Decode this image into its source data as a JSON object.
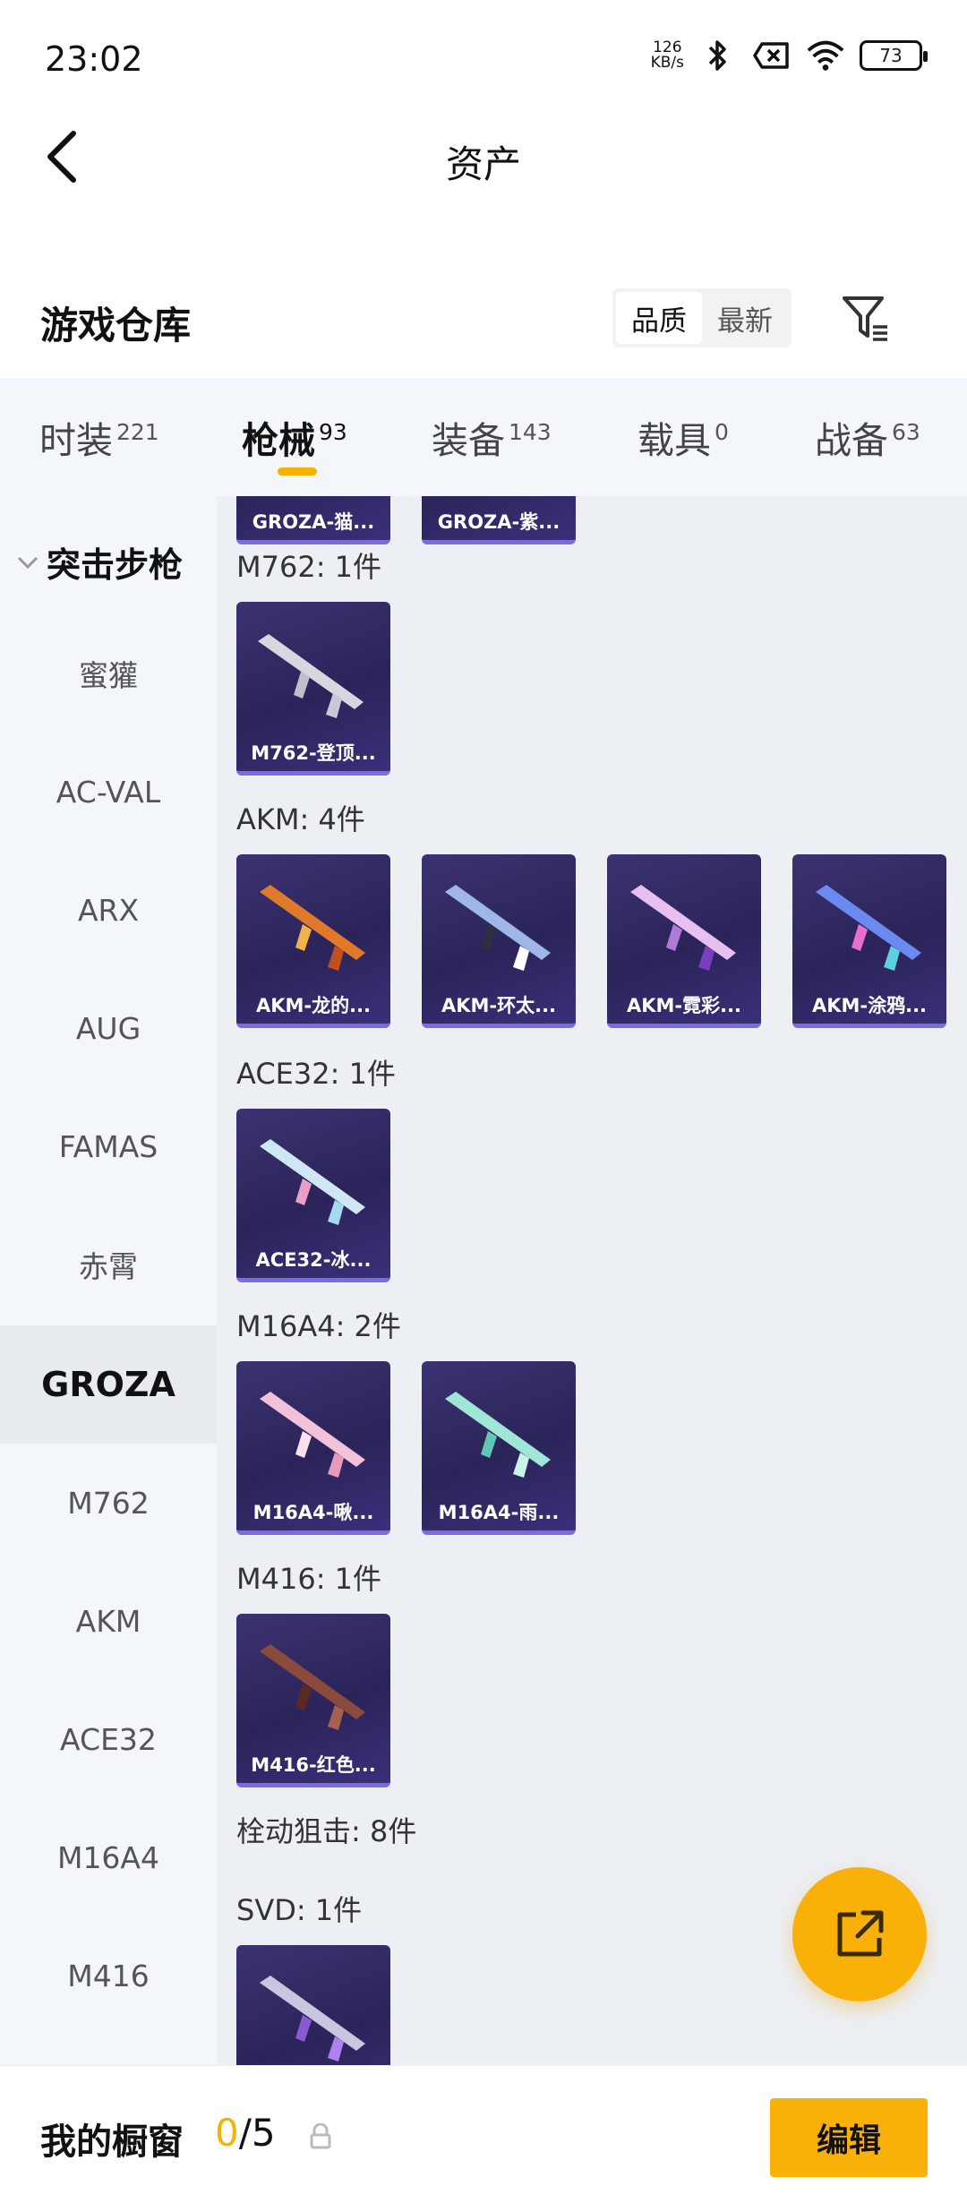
{
  "status": {
    "time": "23:02",
    "speed_top": "126",
    "speed_bottom": "KB/s",
    "battery": "73"
  },
  "header": {
    "title": "资产",
    "back_icon": "back-chevron-icon"
  },
  "warehouse": {
    "title": "游戏仓库",
    "sort_options": [
      "品质",
      "最新"
    ],
    "active_sort": "品质",
    "filter_icon": "filter-icon"
  },
  "tabs": [
    {
      "label": "时装",
      "count": "221"
    },
    {
      "label": "枪械",
      "count": "93"
    },
    {
      "label": "装备",
      "count": "143"
    },
    {
      "label": "载具",
      "count": "0"
    },
    {
      "label": "战备",
      "count": "63"
    }
  ],
  "active_tab": "枪械",
  "sidebar": {
    "group": "突击步枪",
    "items": [
      "蜜獾",
      "AC-VAL",
      "ARX",
      "AUG",
      "FAMAS",
      "赤霄",
      "GROZA",
      "M762",
      "AKM",
      "ACE32",
      "M16A4",
      "M416"
    ],
    "active": "GROZA"
  },
  "content": {
    "partial_cards": [
      "GROZA-猫...",
      "GROZA-紫..."
    ],
    "groups": [
      {
        "label": "M762: 1件",
        "items": [
          "M762-登顶..."
        ]
      },
      {
        "label": "AKM: 4件",
        "items": [
          "AKM-龙的...",
          "AKM-环太...",
          "AKM-霓彩...",
          "AKM-涂鸦..."
        ]
      },
      {
        "label": "ACE32: 1件",
        "items": [
          "ACE32-冰..."
        ]
      },
      {
        "label": "M16A4: 2件",
        "items": [
          "M16A4-啾...",
          "M16A4-雨..."
        ]
      },
      {
        "label": "M416: 1件",
        "items": [
          "M416-红色..."
        ]
      }
    ],
    "category_label": "栓动狙击: 8件",
    "svd_label": "SVD: 1件"
  },
  "bottom": {
    "showcase_label": "我的橱窗",
    "showcase_used": "0",
    "showcase_total": "/5",
    "edit_label": "编辑"
  },
  "colors": {
    "accent": "#f9b10a",
    "card_bg": "#2b2459",
    "card_border": "#7b6ae0"
  }
}
